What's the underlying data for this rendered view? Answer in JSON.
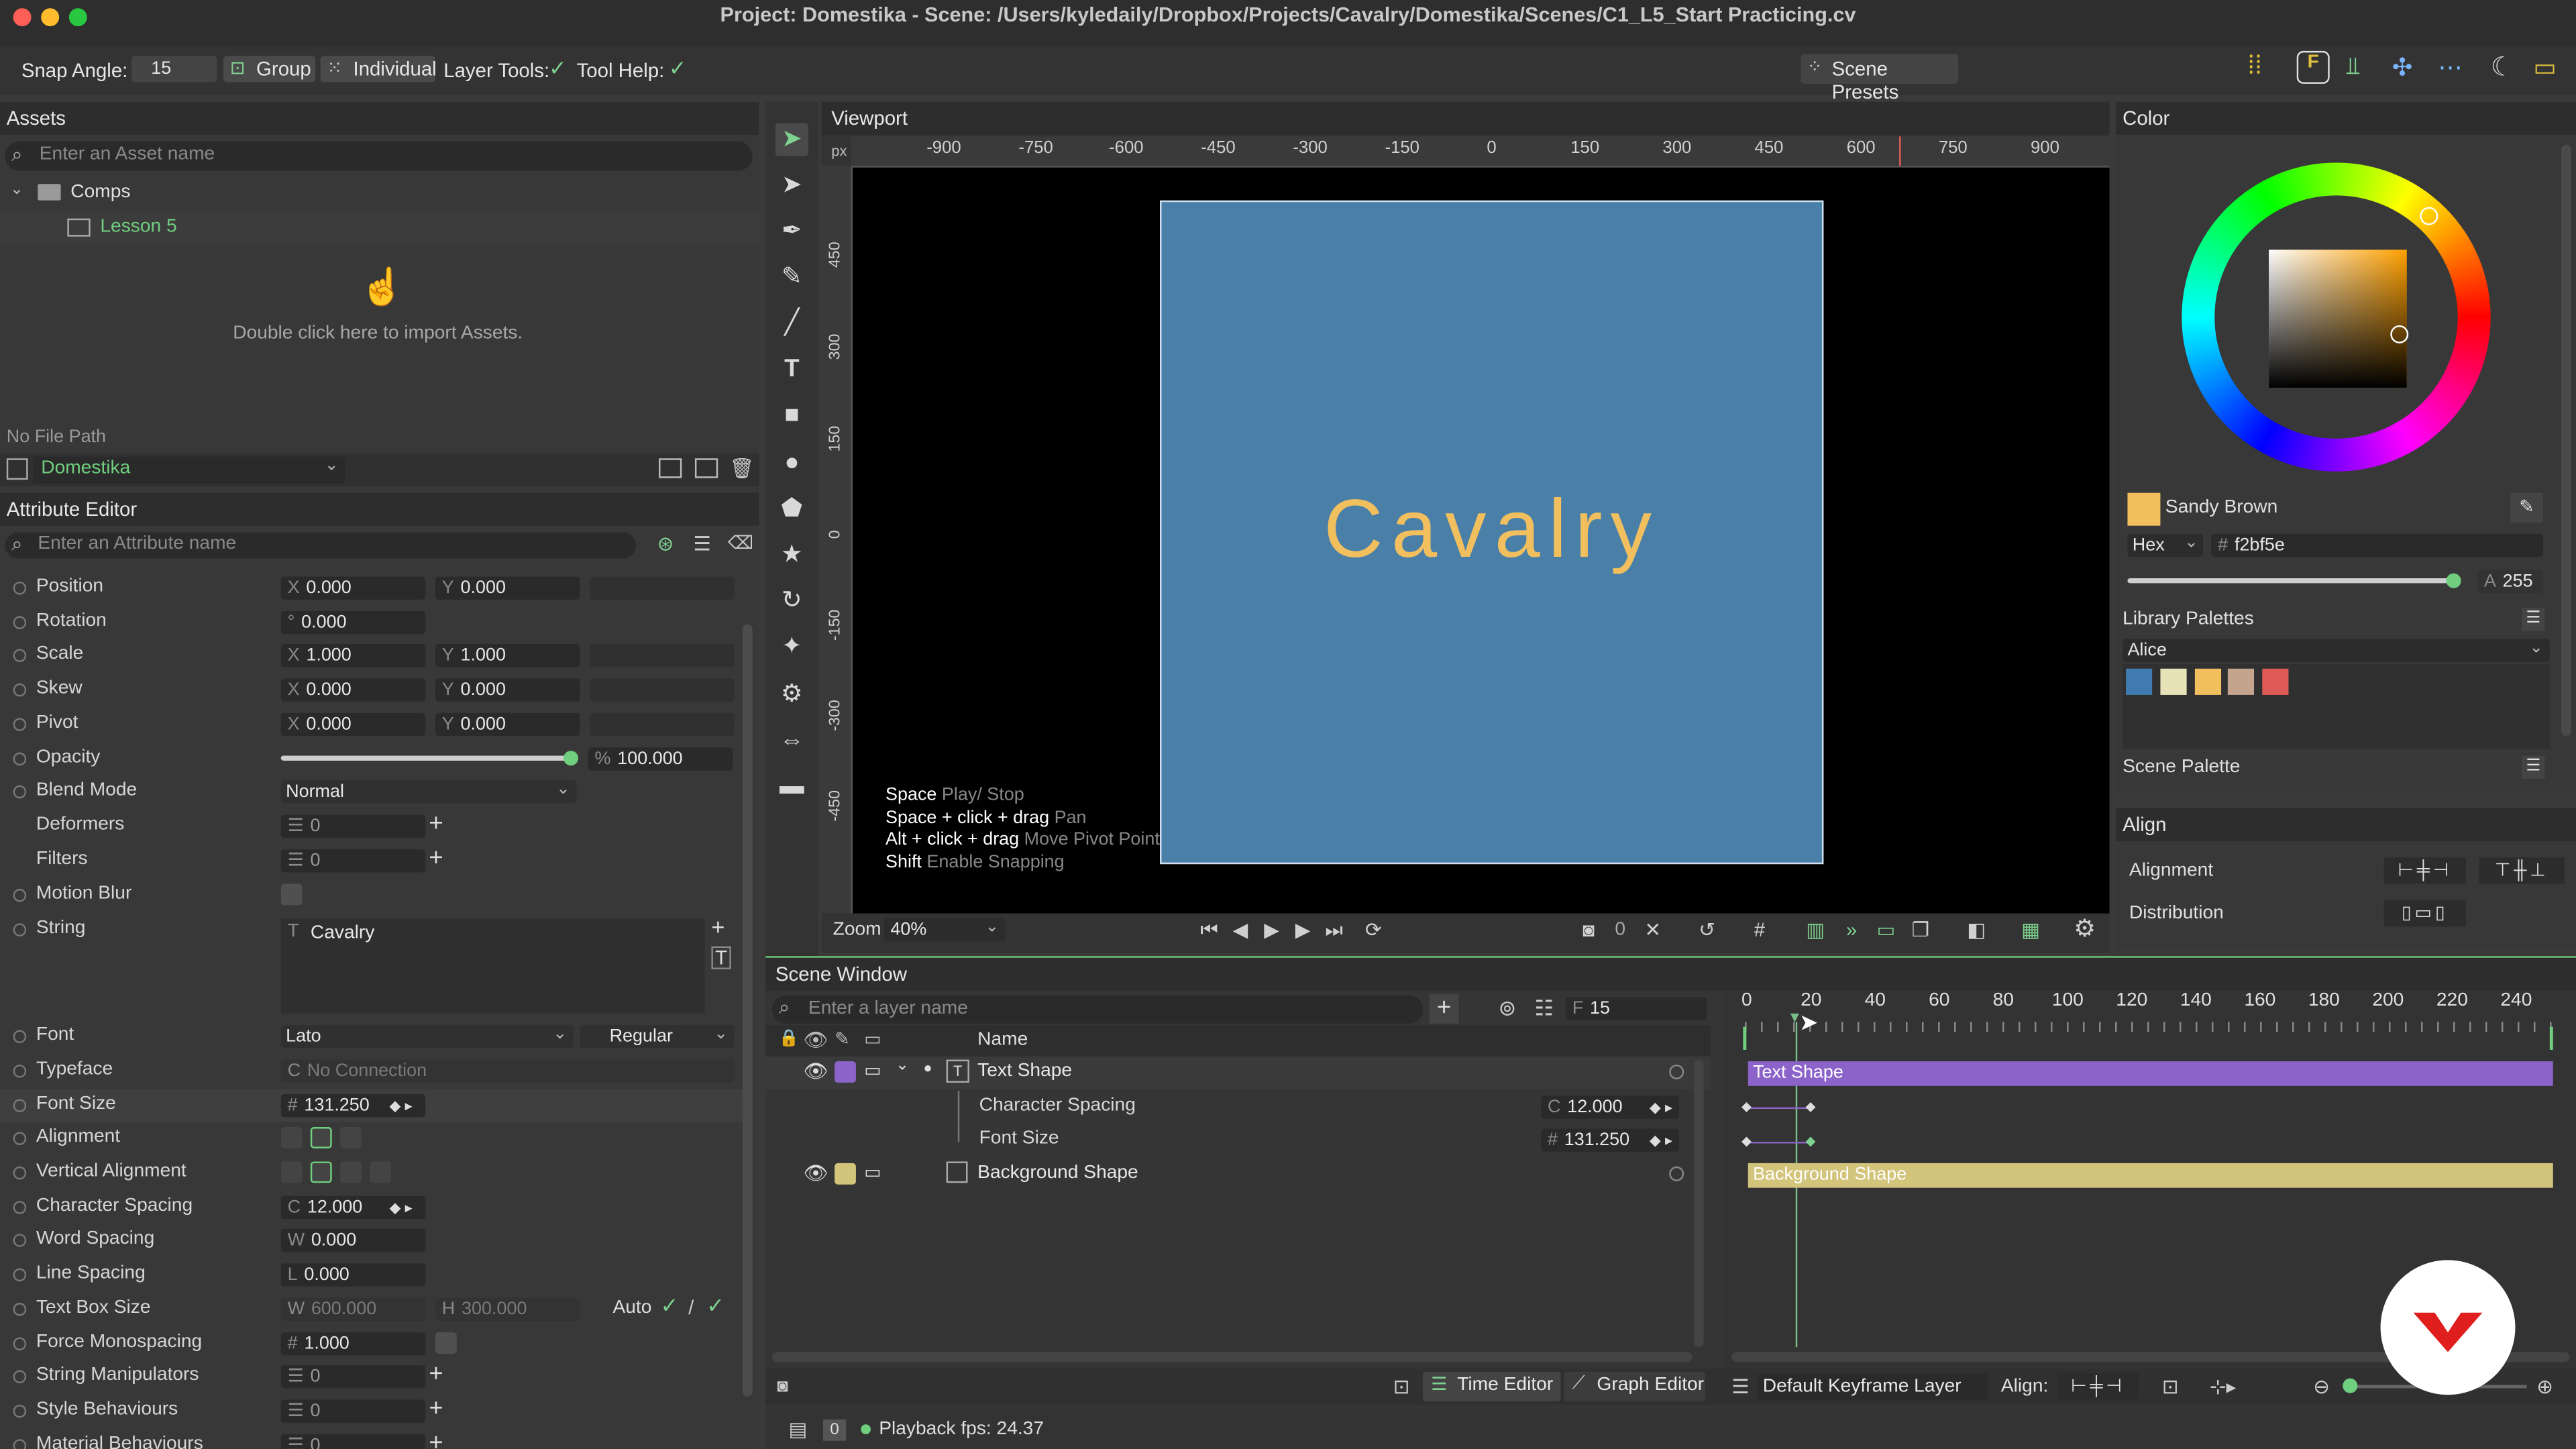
{
  "window": {
    "title": "Project: Domestika - Scene: /Users/kyledaily/Dropbox/Projects/Cavalry/Domestika/Scenes/C1_L5_Start Practicing.cv"
  },
  "toolbar": {
    "snap_label": "Snap Angle:",
    "snap_value": "15",
    "group_label": "Group",
    "individual_label": "Individual",
    "layer_tools_label": "Layer Tools:",
    "tool_help_label": "Tool Help:",
    "scene_presets_label": "Scene Presets"
  },
  "assets": {
    "title": "Assets",
    "search_placeholder": "Enter an Asset name",
    "tree": [
      {
        "label": "Comps"
      },
      {
        "label": "Lesson 5"
      }
    ],
    "import_hint": "Double click here to import Assets.",
    "file_path": "No File Path",
    "project": "Domestika"
  },
  "attr": {
    "title": "Attribute Editor",
    "search_placeholder": "Enter an Attribute name",
    "position": {
      "label": "Position",
      "x": "0.000",
      "y": "0.000"
    },
    "rotation": {
      "label": "Rotation",
      "v": "0.000"
    },
    "scale": {
      "label": "Scale",
      "x": "1.000",
      "y": "1.000"
    },
    "skew": {
      "label": "Skew",
      "x": "0.000",
      "y": "0.000"
    },
    "pivot": {
      "label": "Pivot",
      "x": "0.000",
      "y": "0.000"
    },
    "opacity": {
      "label": "Opacity",
      "v": "100.000",
      "level": 1.0
    },
    "blend": {
      "label": "Blend Mode",
      "v": "Normal"
    },
    "deformers": {
      "label": "Deformers",
      "v": "0"
    },
    "filters": {
      "label": "Filters",
      "v": "0"
    },
    "motion_blur": {
      "label": "Motion Blur"
    },
    "string": {
      "label": "String",
      "v": "Cavalry"
    },
    "font": {
      "label": "Font",
      "family": "Lato",
      "style": "Regular"
    },
    "typeface": {
      "label": "Typeface",
      "v": "No Connection"
    },
    "font_size": {
      "label": "Font Size",
      "v": "131.250"
    },
    "alignment": {
      "label": "Alignment"
    },
    "valign": {
      "label": "Vertical Alignment"
    },
    "char_spacing": {
      "label": "Character Spacing",
      "v": "12.000"
    },
    "word_spacing": {
      "label": "Word Spacing",
      "v": "0.000"
    },
    "line_spacing": {
      "label": "Line Spacing",
      "v": "0.000"
    },
    "text_box": {
      "label": "Text Box Size",
      "w": "600.000",
      "h": "300.000",
      "auto": "Auto"
    },
    "force_mono": {
      "label": "Force Monospacing",
      "v": "1.000"
    },
    "string_manip": {
      "label": "String Manipulators",
      "v": "0"
    },
    "style_behav": {
      "label": "Style Behaviours",
      "v": "0"
    },
    "material_behav": {
      "label": "Material Behaviours",
      "v": "0"
    }
  },
  "viewport": {
    "title": "Viewport",
    "unit": "px",
    "hticks": [
      "-900",
      "-750",
      "-600",
      "-450",
      "-300",
      "-150",
      "0",
      "150",
      "300",
      "450",
      "600",
      "750",
      "900"
    ],
    "vticks": [
      "450",
      "300",
      "150",
      "0",
      "-150",
      "-300",
      "-450"
    ],
    "canvas_text": "Cavalry",
    "hints": [
      {
        "key": "Space",
        "desc": "Play/ Stop"
      },
      {
        "key": "Space + click + drag",
        "desc": "Pan"
      },
      {
        "key": "Alt + click + drag",
        "desc": "Move Pivot Point"
      },
      {
        "key": "Shift",
        "desc": "Enable Snapping"
      }
    ],
    "zoom_label": "Zoom",
    "zoom_value": "40%",
    "frame_value": "0"
  },
  "color": {
    "title": "Color",
    "name": "Sandy Brown",
    "mode": "Hex",
    "hex": "f2bf5e",
    "alpha": "255",
    "library_title": "Library Palettes",
    "palette_name": "Alice",
    "palette": [
      "#3f7bb0",
      "#e8e2b8",
      "#f2bf5e",
      "#c4a48c",
      "#e05a55"
    ],
    "scene_palette_title": "Scene Palette",
    "swatch_color": "#f2bf5e",
    "wheel_marker_angle_deg": 48
  },
  "align": {
    "title": "Align",
    "alignment_label": "Alignment",
    "distribution_label": "Distribution"
  },
  "scene": {
    "title": "Scene Window",
    "search_placeholder": "Enter a layer name",
    "frame_label": "F",
    "frame_value": "15",
    "name_header": "Name",
    "layers": [
      {
        "name": "Text Shape",
        "color": "#8b63c9"
      },
      {
        "name": "Character Spacing",
        "value": "12.000"
      },
      {
        "name": "Font Size",
        "value": "131.250"
      },
      {
        "name": "Background Shape",
        "color": "#d2c47a"
      }
    ],
    "ticks": [
      "0",
      "20",
      "40",
      "60",
      "80",
      "100",
      "120",
      "140",
      "160",
      "180",
      "200",
      "220",
      "240"
    ],
    "text_bar_label": "Text Shape",
    "bg_bar_label": "Background Shape",
    "time_editor_label": "Time Editor",
    "graph_editor_label": "Graph Editor",
    "keyframe_layer": "Default Keyframe Layer",
    "align_label": "Align:"
  },
  "status": {
    "count": "0",
    "fps": "Playback fps: 24.37"
  }
}
